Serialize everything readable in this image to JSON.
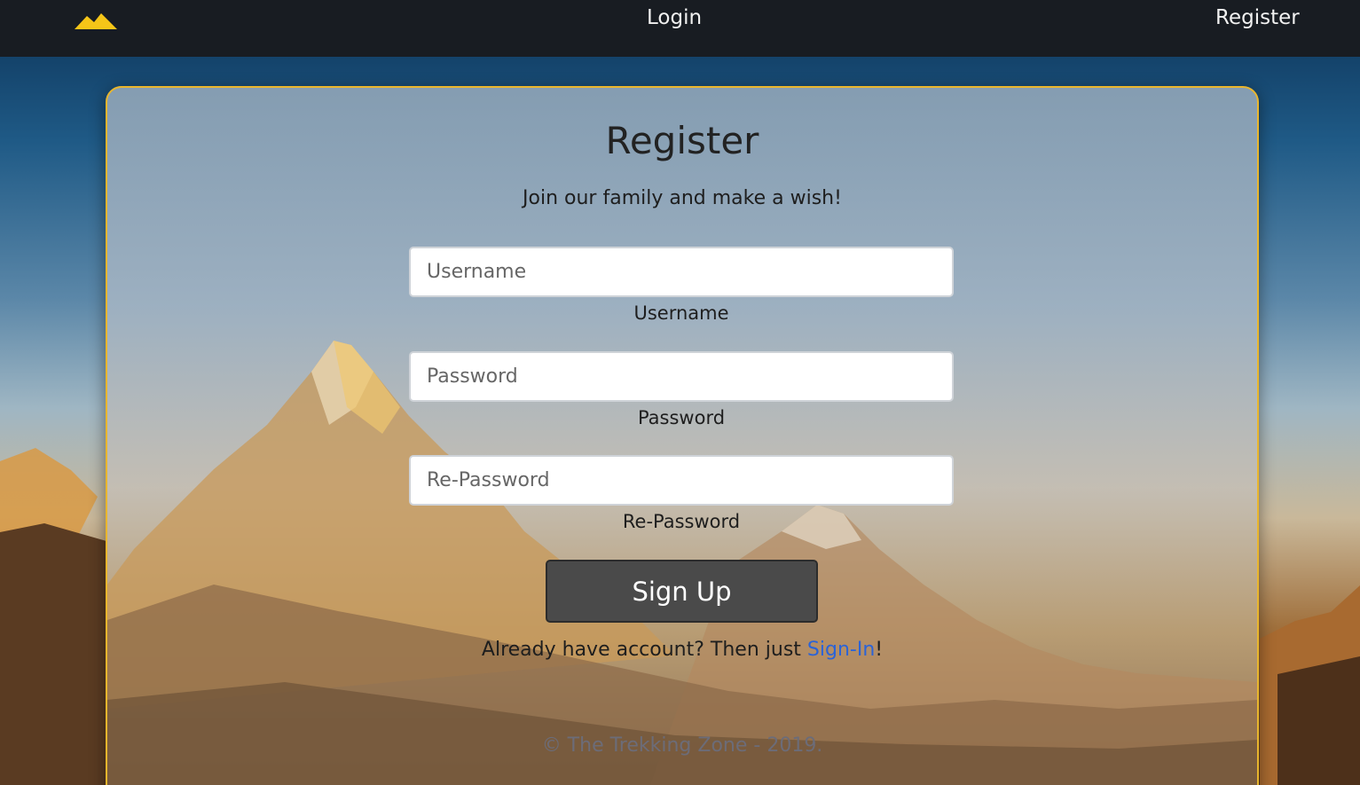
{
  "nav": {
    "logo_icon": "mountain-logo-icon",
    "login_label": "Login",
    "register_label": "Register"
  },
  "form": {
    "title": "Register",
    "subtitle": "Join our family and make a wish!",
    "fields": [
      {
        "placeholder": "Username",
        "value": "",
        "label": "Username"
      },
      {
        "placeholder": "Password",
        "value": "",
        "label": "Password"
      },
      {
        "placeholder": "Re-Password",
        "value": "",
        "label": "Re-Password"
      }
    ],
    "submit_label": "Sign Up",
    "signin_prefix": "Already have account? Then just ",
    "signin_link": "Sign-In",
    "signin_suffix": "!"
  },
  "footer": {
    "copyright": "© The Trekking Zone - 2019."
  },
  "colors": {
    "navbar": "#181c22",
    "card_border": "#e9b62d",
    "button": "#4a4a4a",
    "link": "#2a63d8",
    "logo": "#f5c518"
  }
}
